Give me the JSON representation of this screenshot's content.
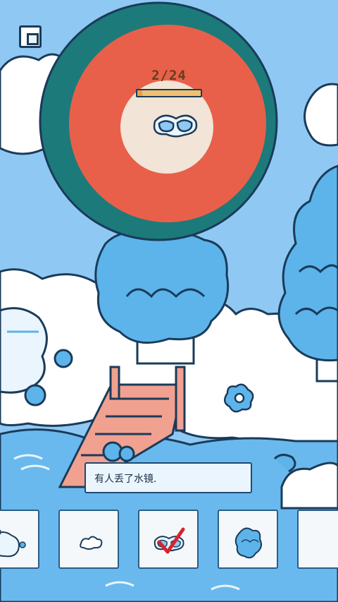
{
  "hud": {
    "found_count": "2/24",
    "progress_fraction": 0.08
  },
  "target": {
    "icon": "swim-goggles-icon"
  },
  "dialog": {
    "text": "有人丢了水镜."
  },
  "item_cards": [
    {
      "icon": "snowy-creature-icon",
      "found": false
    },
    {
      "icon": "small-cloud-icon",
      "found": false
    },
    {
      "icon": "swim-goggles-icon",
      "found": true
    },
    {
      "icon": "blue-bush-icon",
      "found": false
    }
  ],
  "colors": {
    "sky": "#8fc9f3",
    "lens_outer": "#1c7a7a",
    "lens_ring": "#e8604a",
    "lens_center": "#f2e4d6",
    "progress_fill": "#e8a046",
    "check": "#d62430"
  }
}
